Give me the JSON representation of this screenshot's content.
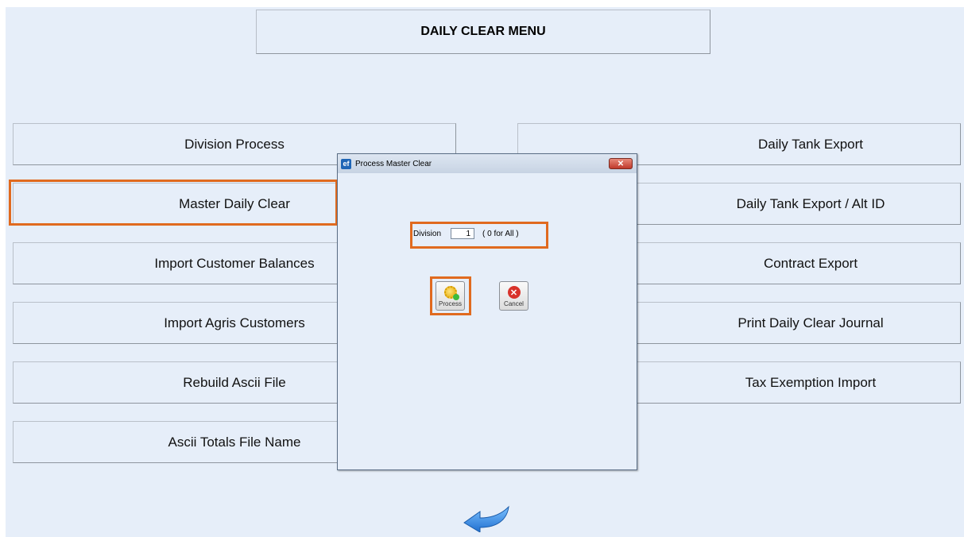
{
  "title": "DAILY CLEAR MENU",
  "left_buttons": [
    {
      "label": "Division Process"
    },
    {
      "label": "Master Daily Clear"
    },
    {
      "label": "Import Customer Balances"
    },
    {
      "label": "Import Agris Customers"
    },
    {
      "label": "Rebuild Ascii File"
    },
    {
      "label": "Ascii Totals File Name"
    }
  ],
  "right_buttons": [
    {
      "label": "Daily Tank Export"
    },
    {
      "label": "Daily Tank Export / Alt ID"
    },
    {
      "label": "Contract Export"
    },
    {
      "label": "Print Daily Clear Journal"
    },
    {
      "label": "Tax Exemption Import"
    }
  ],
  "dialog": {
    "app_icon": "ef",
    "title": "Process Master Clear",
    "close_label": "✕",
    "division_label": "Division",
    "division_value": "1",
    "division_hint": "( 0 for All )",
    "process_label": "Process",
    "cancel_label": "Cancel"
  },
  "icons": {
    "process": "gear-check-icon",
    "cancel": "red-x-icon",
    "back": "back-arrow-icon"
  },
  "colors": {
    "highlight": "#e06a1f",
    "panel_bg": "#e6eef9",
    "arrow": "#2e7fd8"
  }
}
